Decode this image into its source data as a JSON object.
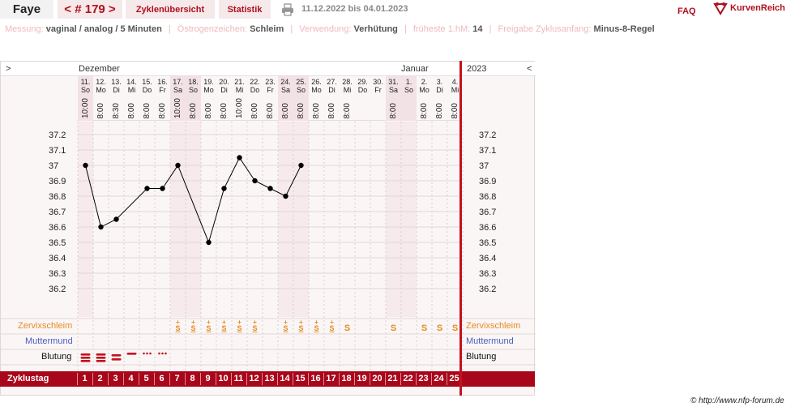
{
  "header": {
    "name": "Faye",
    "cycle_nav": "< # 179 >",
    "zyklen_label": "Zyklenübersicht",
    "statistik_label": "Statistik",
    "date_range": "11.12.2022 bis 04.01.2023",
    "faq_label": "FAQ",
    "logo_text": "KurvenReich",
    "print_icon": "printer-icon"
  },
  "settings": {
    "messung_label": "Messung:",
    "messung_value": "vaginal / analog / 5 Minuten",
    "oestrogen_label": "Östrogenzeichen:",
    "oestrogen_value": "Schleim",
    "verwendung_label": "Verwendung:",
    "verwendung_value": "Verhütung",
    "hm_label": "früheste 1.hM:",
    "hm_value": "14",
    "freigabe_label": "Freigabe Zyklusanfang:",
    "freigabe_value": "Minus-8-Regel"
  },
  "chart": {
    "left_arrow": ">",
    "right_arrow": "<",
    "month_dec": "Dezember",
    "month_jan": "Januar",
    "year": "2023",
    "row_labels": {
      "zervix": "Zervixschleim",
      "muttermund": "Muttermund",
      "blutung": "Blutung",
      "zyklustag": "Zyklustag"
    },
    "credit": "© http://www.nfp-forum.de"
  },
  "colors": {
    "accent": "#b01020",
    "bar": "#a8061a",
    "zervix": "#e58a1f",
    "muttermund": "#4a5fc1",
    "line": "#000000"
  },
  "days": [
    {
      "date": "11.",
      "wd": "So",
      "time": "10:00",
      "weekend": true
    },
    {
      "date": "12.",
      "wd": "Mo",
      "time": "8:00",
      "weekend": false
    },
    {
      "date": "13.",
      "wd": "Di",
      "time": "8:30",
      "weekend": false
    },
    {
      "date": "14.",
      "wd": "Mi",
      "time": "8:00",
      "weekend": false
    },
    {
      "date": "15.",
      "wd": "Do",
      "time": "8:00",
      "weekend": false
    },
    {
      "date": "16.",
      "wd": "Fr",
      "time": "8:00",
      "weekend": false
    },
    {
      "date": "17.",
      "wd": "Sa",
      "time": "10:00",
      "weekend": true
    },
    {
      "date": "18.",
      "wd": "So",
      "time": "8:00",
      "weekend": true
    },
    {
      "date": "19.",
      "wd": "Mo",
      "time": "8:00",
      "weekend": false
    },
    {
      "date": "20.",
      "wd": "Di",
      "time": "8:00",
      "weekend": false
    },
    {
      "date": "21.",
      "wd": "Mi",
      "time": "10:00",
      "weekend": false
    },
    {
      "date": "22.",
      "wd": "Do",
      "time": "8:00",
      "weekend": false
    },
    {
      "date": "23.",
      "wd": "Fr",
      "time": "8:00",
      "weekend": false
    },
    {
      "date": "24.",
      "wd": "Sa",
      "time": "8:00",
      "weekend": true
    },
    {
      "date": "25.",
      "wd": "So",
      "time": "8:00",
      "weekend": true
    },
    {
      "date": "26.",
      "wd": "Mo",
      "time": "8:00",
      "weekend": false
    },
    {
      "date": "27.",
      "wd": "Di",
      "time": "8:00",
      "weekend": false
    },
    {
      "date": "28.",
      "wd": "Mi",
      "time": "8:00",
      "weekend": false
    },
    {
      "date": "29.",
      "wd": "Do",
      "time": "",
      "weekend": false
    },
    {
      "date": "30.",
      "wd": "Fr",
      "time": "",
      "weekend": false
    },
    {
      "date": "31.",
      "wd": "Sa",
      "time": "8:00",
      "weekend": true
    },
    {
      "date": "1.",
      "wd": "So",
      "time": "",
      "weekend": true
    },
    {
      "date": "2.",
      "wd": "Mo",
      "time": "8:00",
      "weekend": false
    },
    {
      "date": "3.",
      "wd": "Di",
      "time": "8:00",
      "weekend": false
    },
    {
      "date": "4.",
      "wd": "Mi",
      "time": "8:00",
      "weekend": false
    }
  ],
  "chart_data": {
    "type": "line",
    "title": "",
    "xlabel": "Zyklustag",
    "ylabel": "",
    "ylim": [
      36.2,
      37.2
    ],
    "yticks": [
      "37.2",
      "37.1",
      "37",
      "36.9",
      "36.8",
      "36.7",
      "36.6",
      "36.5",
      "36.4",
      "36.3",
      "36.2"
    ],
    "cycle_days": [
      1,
      2,
      3,
      4,
      5,
      6,
      7,
      8,
      9,
      10,
      11,
      12,
      13,
      14,
      15,
      16,
      17,
      18,
      19,
      20,
      21,
      22,
      23,
      24,
      25
    ],
    "temperatures": [
      37.0,
      36.6,
      36.65,
      null,
      36.85,
      36.85,
      37.0,
      null,
      36.5,
      36.85,
      37.05,
      36.9,
      36.85,
      36.8,
      37.0,
      null,
      null,
      null,
      null,
      null,
      null,
      null,
      null,
      null,
      null
    ],
    "zervixschleim": [
      "",
      "",
      "",
      "",
      "",
      "",
      "S+",
      "S+",
      "S+",
      "S+",
      "S+",
      "S+",
      "",
      "S+",
      "S+",
      "S+",
      "S+",
      "S",
      "",
      "",
      "S",
      "",
      "S",
      "S",
      "S"
    ],
    "blutung": [
      "heavy",
      "heavy",
      "medium",
      "light",
      "spotting",
      "spotting",
      "",
      "",
      "",
      "",
      "",
      "",
      "",
      "",
      "",
      "",
      "",
      "",
      "",
      "",
      "",
      "",
      "",
      "",
      ""
    ],
    "grid": true
  }
}
